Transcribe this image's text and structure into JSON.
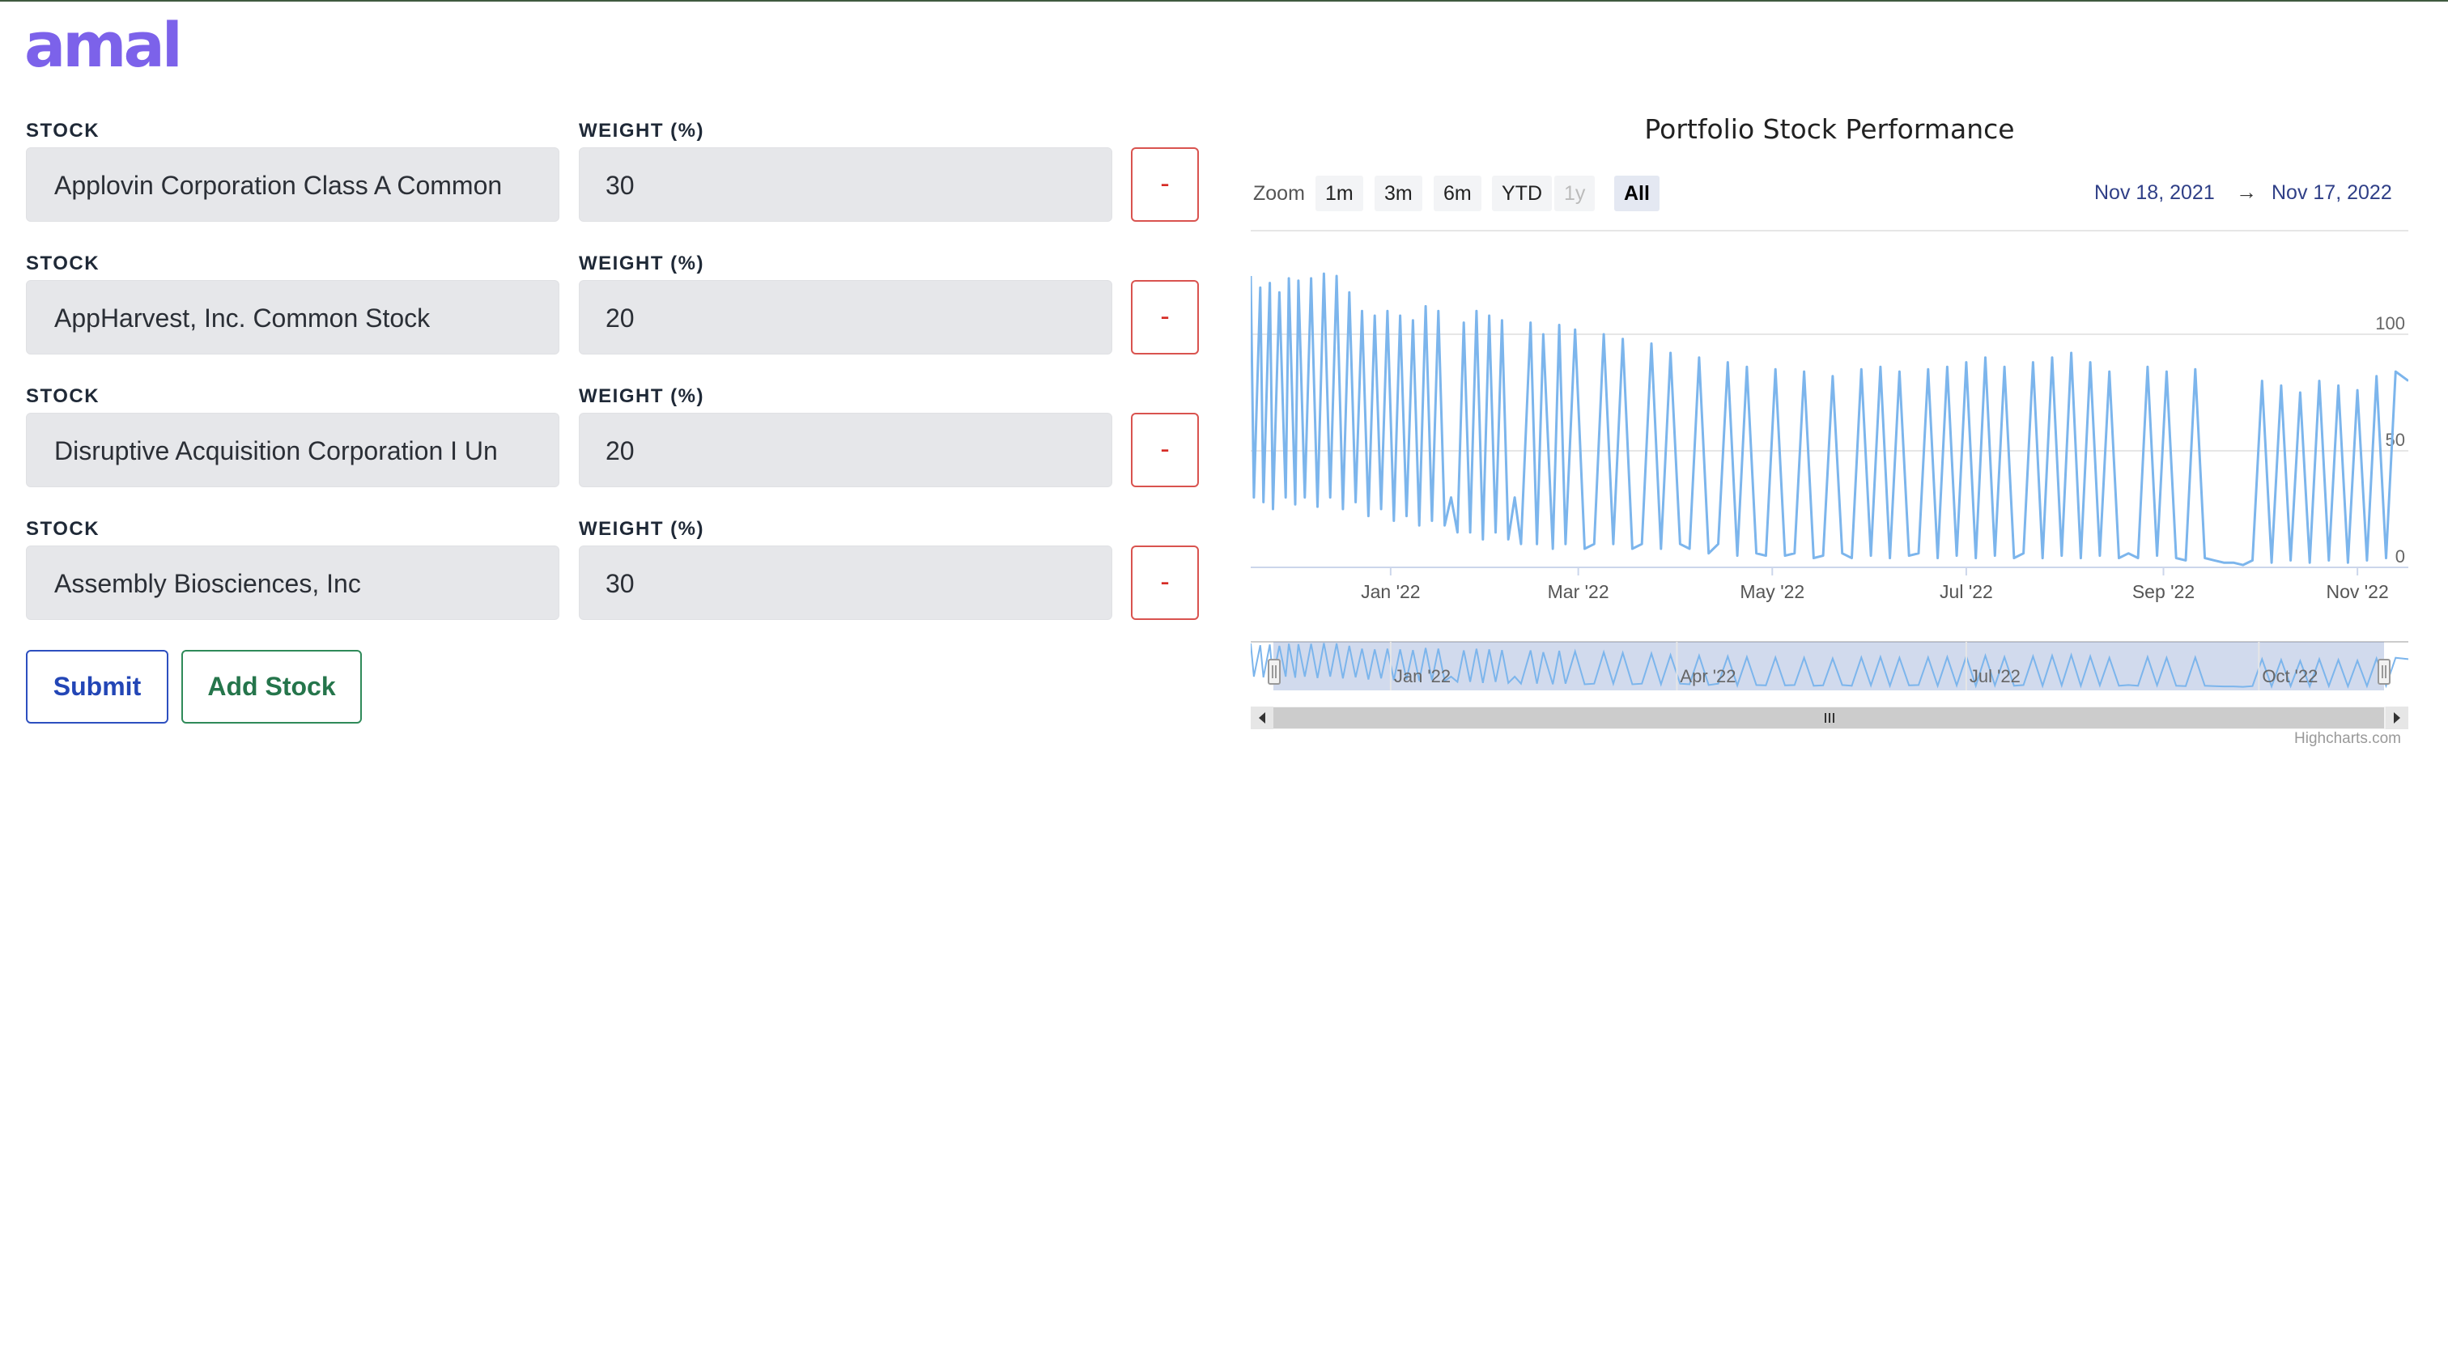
{
  "app": {
    "logo": "amal"
  },
  "form": {
    "stock_label": "STOCK",
    "weight_label": "WEIGHT (%)",
    "remove_label": "-",
    "rows": [
      {
        "stock": "Applovin Corporation Class A Common",
        "weight": "30"
      },
      {
        "stock": "AppHarvest, Inc. Common Stock",
        "weight": "20"
      },
      {
        "stock": "Disruptive Acquisition Corporation I Un",
        "weight": "20"
      },
      {
        "stock": "Assembly Biosciences, Inc",
        "weight": "30"
      }
    ],
    "submit_label": "Submit",
    "add_label": "Add Stock"
  },
  "chart": {
    "zoom_label": "Zoom",
    "zoom_buttons": [
      {
        "label": "1m",
        "state": "normal"
      },
      {
        "label": "3m",
        "state": "normal"
      },
      {
        "label": "6m",
        "state": "normal"
      },
      {
        "label": "YTD",
        "state": "normal"
      },
      {
        "label": "1y",
        "state": "disabled"
      },
      {
        "label": "All",
        "state": "active"
      }
    ],
    "range_from": "Nov 18, 2021",
    "range_arrow": "→",
    "range_to": "Nov 17, 2022",
    "credits": "Highcharts.com"
  },
  "chart_data": {
    "type": "line",
    "title": "Portfolio Stock Performance",
    "xlabel": "",
    "ylabel": "",
    "x_range": [
      "2021-11-18",
      "2022-11-17"
    ],
    "ylim": [
      0,
      125
    ],
    "y_ticks": [
      "0",
      "50",
      "100"
    ],
    "x_ticks": [
      {
        "label": "Jan '22",
        "date": "2022-01-01"
      },
      {
        "label": "Mar '22",
        "date": "2022-03-01"
      },
      {
        "label": "May '22",
        "date": "2022-05-01"
      },
      {
        "label": "Jul '22",
        "date": "2022-07-01"
      },
      {
        "label": "Sep '22",
        "date": "2022-09-01"
      },
      {
        "label": "Nov '22",
        "date": "2022-11-01"
      }
    ],
    "navigator_ticks": [
      {
        "label": "Jan '22",
        "date": "2022-01-01"
      },
      {
        "label": "Apr '22",
        "date": "2022-04-01"
      },
      {
        "label": "Jul '22",
        "date": "2022-07-01"
      },
      {
        "label": "Oct '22",
        "date": "2022-10-01"
      }
    ],
    "grid": true,
    "color": "#7cb5ec",
    "series": [
      {
        "x": [
          "2021-11-18",
          "2021-11-19",
          "2021-11-21",
          "2021-11-22",
          "2021-11-24",
          "2021-11-25",
          "2021-11-27",
          "2021-11-29",
          "2021-11-30",
          "2021-12-02",
          "2021-12-03",
          "2021-12-05",
          "2021-12-07",
          "2021-12-09",
          "2021-12-11",
          "2021-12-13",
          "2021-12-15",
          "2021-12-17",
          "2021-12-19",
          "2021-12-21",
          "2021-12-23",
          "2021-12-25",
          "2021-12-27",
          "2021-12-29",
          "2021-12-31",
          "2022-01-02",
          "2022-01-04",
          "2022-01-06",
          "2022-01-08",
          "2022-01-10",
          "2022-01-12",
          "2022-01-14",
          "2022-01-16",
          "2022-01-18",
          "2022-01-20",
          "2022-01-22",
          "2022-01-24",
          "2022-01-26",
          "2022-01-28",
          "2022-01-30",
          "2022-02-01",
          "2022-02-03",
          "2022-02-05",
          "2022-02-07",
          "2022-02-09",
          "2022-02-11",
          "2022-02-14",
          "2022-02-16",
          "2022-02-18",
          "2022-02-21",
          "2022-02-23",
          "2022-02-25",
          "2022-02-28",
          "2022-03-03",
          "2022-03-06",
          "2022-03-09",
          "2022-03-12",
          "2022-03-15",
          "2022-03-18",
          "2022-03-21",
          "2022-03-24",
          "2022-03-27",
          "2022-03-30",
          "2022-04-02",
          "2022-04-05",
          "2022-04-08",
          "2022-04-11",
          "2022-04-14",
          "2022-04-17",
          "2022-04-20",
          "2022-04-23",
          "2022-04-26",
          "2022-04-29",
          "2022-05-02",
          "2022-05-05",
          "2022-05-08",
          "2022-05-11",
          "2022-05-14",
          "2022-05-17",
          "2022-05-20",
          "2022-05-23",
          "2022-05-26",
          "2022-05-29",
          "2022-06-01",
          "2022-06-04",
          "2022-06-07",
          "2022-06-10",
          "2022-06-13",
          "2022-06-16",
          "2022-06-19",
          "2022-06-22",
          "2022-06-25",
          "2022-06-28",
          "2022-07-01",
          "2022-07-04",
          "2022-07-07",
          "2022-07-10",
          "2022-07-13",
          "2022-07-16",
          "2022-07-19",
          "2022-07-22",
          "2022-07-25",
          "2022-07-28",
          "2022-07-31",
          "2022-08-03",
          "2022-08-06",
          "2022-08-09",
          "2022-08-12",
          "2022-08-15",
          "2022-08-18",
          "2022-08-21",
          "2022-08-24",
          "2022-08-27",
          "2022-08-30",
          "2022-09-02",
          "2022-09-05",
          "2022-09-08",
          "2022-09-11",
          "2022-09-14",
          "2022-09-17",
          "2022-09-20",
          "2022-09-23",
          "2022-09-26",
          "2022-09-29",
          "2022-10-02",
          "2022-10-05",
          "2022-10-08",
          "2022-10-11",
          "2022-10-14",
          "2022-10-17",
          "2022-10-20",
          "2022-10-23",
          "2022-10-26",
          "2022-10-29",
          "2022-11-01",
          "2022-11-04",
          "2022-11-07",
          "2022-11-10",
          "2022-11-13",
          "2022-11-17"
        ],
        "y": [
          125,
          30,
          120,
          28,
          122,
          25,
          118,
          30,
          124,
          27,
          123,
          30,
          124,
          26,
          126,
          30,
          125,
          25,
          118,
          28,
          110,
          22,
          108,
          25,
          110,
          20,
          108,
          22,
          106,
          18,
          112,
          20,
          110,
          18,
          30,
          15,
          105,
          15,
          110,
          12,
          108,
          15,
          106,
          12,
          30,
          10,
          105,
          10,
          100,
          8,
          104,
          10,
          102,
          8,
          10,
          100,
          10,
          98,
          8,
          10,
          96,
          8,
          92,
          10,
          8,
          90,
          6,
          10,
          88,
          5,
          86,
          6,
          5,
          85,
          5,
          6,
          84,
          4,
          5,
          82,
          6,
          4,
          85,
          5,
          86,
          4,
          84,
          5,
          6,
          85,
          4,
          86,
          5,
          88,
          4,
          90,
          5,
          86,
          4,
          6,
          88,
          4,
          90,
          5,
          92,
          4,
          88,
          5,
          84,
          4,
          6,
          4,
          86,
          5,
          84,
          4,
          3,
          85,
          4,
          3,
          2,
          2,
          1,
          3,
          80,
          2,
          78,
          3,
          75,
          2,
          80,
          3,
          78,
          2,
          76,
          3,
          82,
          4,
          84,
          80
        ]
      }
    ]
  }
}
